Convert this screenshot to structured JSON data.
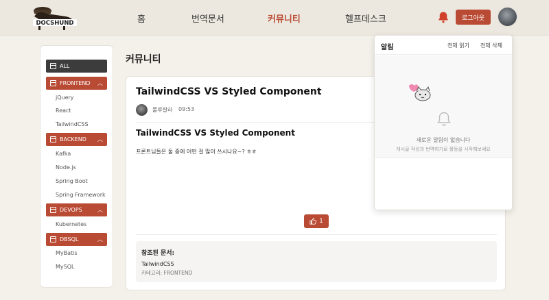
{
  "header": {
    "logo_text": "DOCSHUND",
    "nav": [
      "홈",
      "번역문서",
      "커뮤니티",
      "헬프데스크"
    ],
    "active_nav": "커뮤니티",
    "logout_label": "로그아웃",
    "accent_color": "#b94a34"
  },
  "sidebar": {
    "all_label": "ALL",
    "categories": [
      {
        "label": "FRONTEND",
        "items": [
          "jQuery",
          "React",
          "TailwindCSS"
        ]
      },
      {
        "label": "BACKEND",
        "items": [
          "Kafka",
          "Node.js",
          "Spring Boot",
          "Spring Framework"
        ]
      },
      {
        "label": "DEVOPS",
        "items": [
          "Kubernetes"
        ]
      },
      {
        "label": "DBSQL",
        "items": [
          "MyBatis",
          "MySQL"
        ]
      }
    ]
  },
  "main": {
    "page_title": "커뮤니티",
    "post": {
      "title": "TailwindCSS VS Styled Component",
      "author": "룰루랄라",
      "time": "09:53",
      "content_heading": "TailwindCSS VS Styled Component",
      "content_text": "프론트님들은 둘 중에 어떤 걸 많이 쓰시나요~? ㅎㅎ",
      "like_count": "1"
    },
    "references": {
      "title": "참조된 문서:",
      "doc_title": "TailwindCSS",
      "doc_category": "카테고리: FRONTEND"
    }
  },
  "notifications": {
    "title": "알림",
    "read_all_label": "전체 읽기",
    "delete_all_label": "전체 삭제",
    "empty_title": "새로운 알림이 없습니다",
    "empty_subtitle": "게시글 작성과 번역하기로 활동을 시작해보세요"
  }
}
